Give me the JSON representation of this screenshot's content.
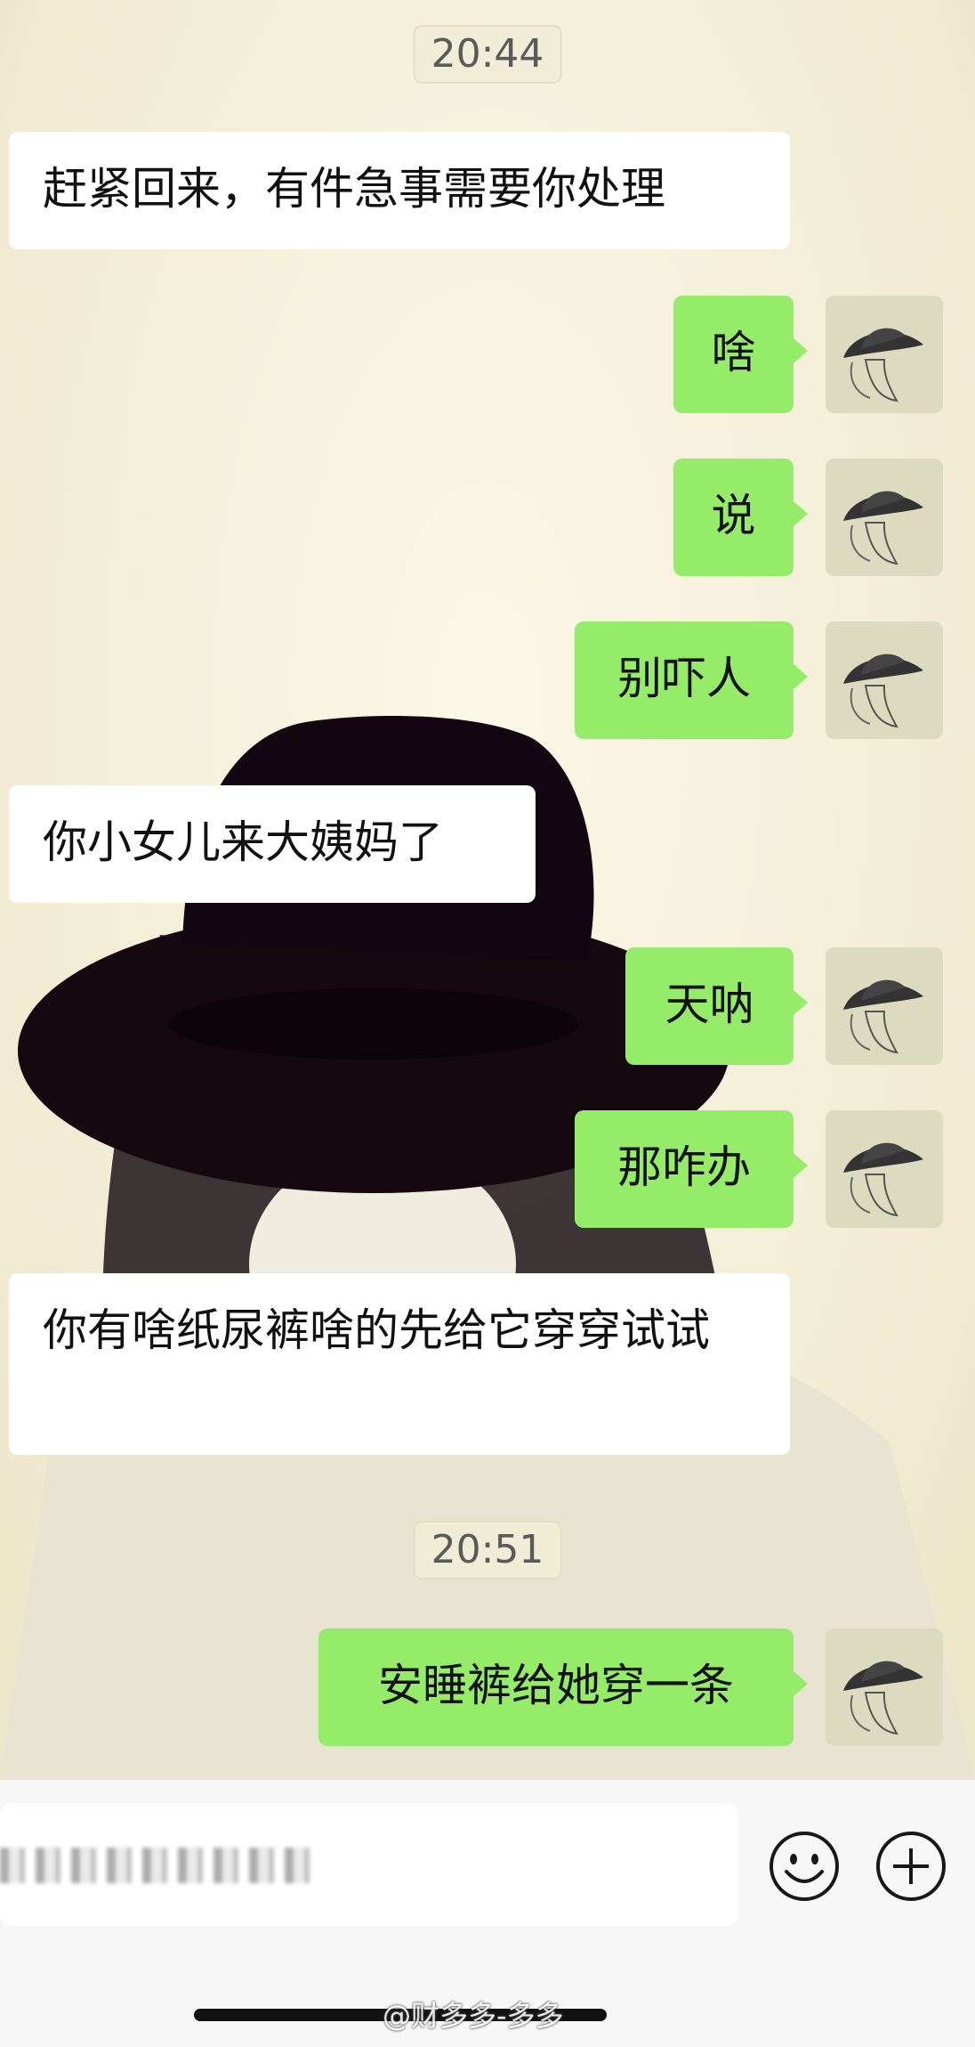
{
  "timestamps": [
    "20:44",
    "20:51"
  ],
  "messages": [
    {
      "side": "in",
      "text": "赶紧回来，有件急事需要你处理"
    },
    {
      "side": "out",
      "text": "啥"
    },
    {
      "side": "out",
      "text": "说"
    },
    {
      "side": "out",
      "text": "别吓人"
    },
    {
      "side": "in",
      "text": "你小女儿来大姨妈了"
    },
    {
      "side": "out",
      "text": "天呐"
    },
    {
      "side": "out",
      "text": "那咋办"
    },
    {
      "side": "in",
      "text": "你有啥纸尿裤啥的先给它穿穿试试"
    },
    {
      "side": "out",
      "text": "安睡裤给她穿一条"
    }
  ],
  "input_bar": {
    "draft_text": "",
    "emoji_icon": "smiley-face-icon",
    "plus_icon": "plus-circle-icon"
  },
  "watermark": "@财多多-多多",
  "colors": {
    "out_bubble": "#95ec69",
    "in_bubble": "#ffffff"
  }
}
